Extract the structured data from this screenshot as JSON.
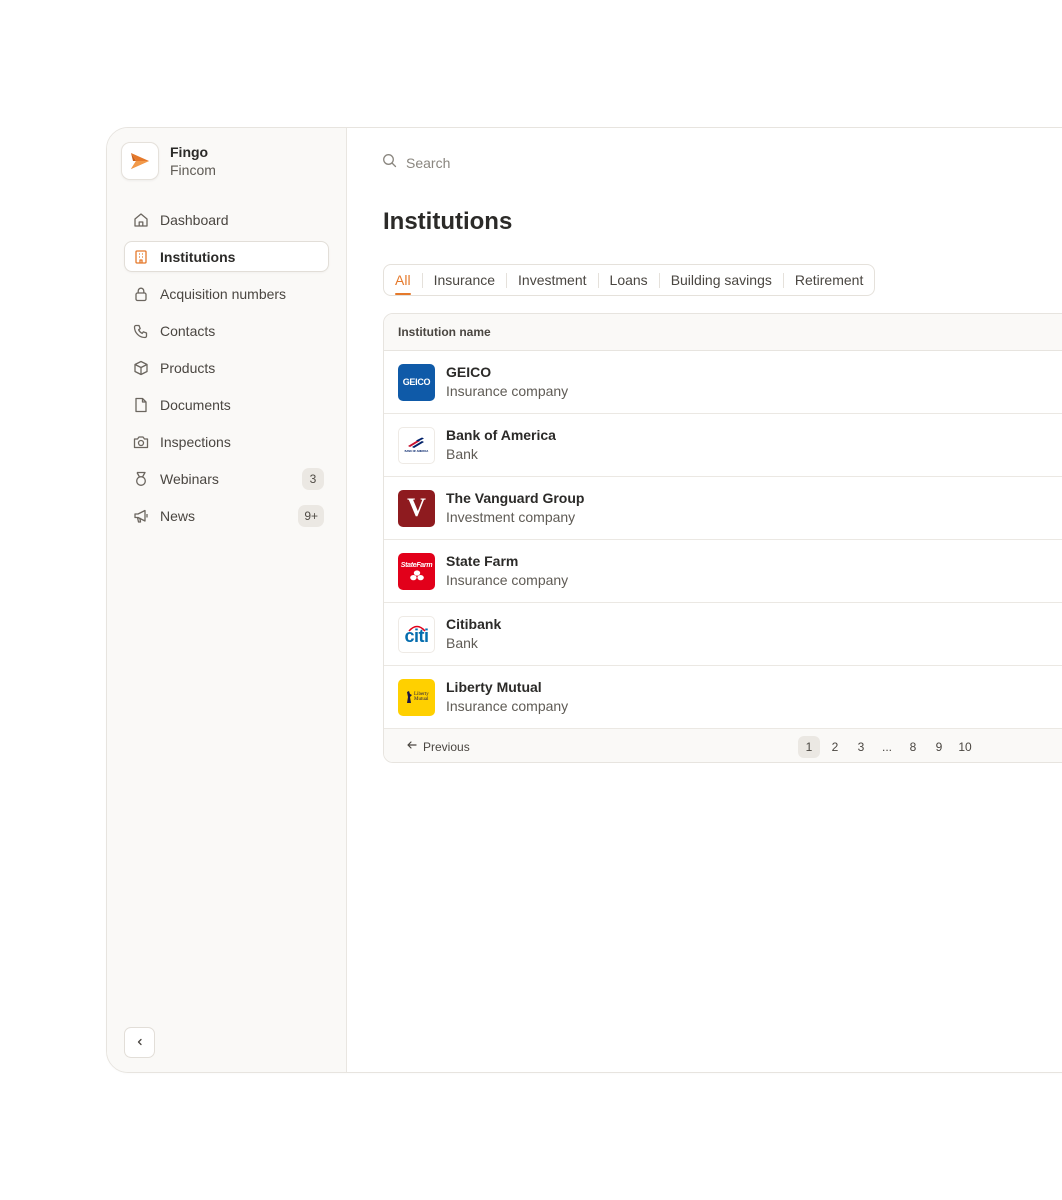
{
  "brand": {
    "name": "Fingo",
    "sub": "Fincom",
    "accent": "#e5792b"
  },
  "search": {
    "placeholder": "Search",
    "icon": "search-icon"
  },
  "sidebar": {
    "items": [
      {
        "label": "Dashboard",
        "icon": "home-icon",
        "active": false
      },
      {
        "label": "Institutions",
        "icon": "building-icon",
        "active": true
      },
      {
        "label": "Acquisition numbers",
        "icon": "lock-icon",
        "active": false
      },
      {
        "label": "Contacts",
        "icon": "phone-icon",
        "active": false
      },
      {
        "label": "Products",
        "icon": "box-icon",
        "active": false
      },
      {
        "label": "Documents",
        "icon": "file-icon",
        "active": false
      },
      {
        "label": "Inspections",
        "icon": "camera-icon",
        "active": false
      },
      {
        "label": "Webinars",
        "icon": "medal-icon",
        "active": false,
        "badge": "3"
      },
      {
        "label": "News",
        "icon": "megaphone-icon",
        "active": false,
        "badge": "9+"
      }
    ],
    "collapse_icon": "chevron-left-icon"
  },
  "page": {
    "title": "Institutions"
  },
  "tabs": [
    {
      "label": "All",
      "active": true
    },
    {
      "label": "Insurance",
      "active": false
    },
    {
      "label": "Investment",
      "active": false
    },
    {
      "label": "Loans",
      "active": false
    },
    {
      "label": "Building savings",
      "active": false
    },
    {
      "label": "Retirement",
      "active": false
    }
  ],
  "table": {
    "header": "Institution name",
    "rows": [
      {
        "name": "GEICO",
        "type": "Insurance company",
        "logo_text": "GEICO",
        "logo_color": "#0f5aa8"
      },
      {
        "name": "Bank of America",
        "type": "Bank",
        "logo_text": "BANK OF AMERICA",
        "logo_color": "#c8102e"
      },
      {
        "name": "The Vanguard Group",
        "type": "Investment company",
        "logo_text": "V",
        "logo_color": "#8e1b1f"
      },
      {
        "name": "State Farm",
        "type": "Insurance company",
        "logo_text": "StateFarm",
        "logo_color": "#e2001a"
      },
      {
        "name": "Citibank",
        "type": "Bank",
        "logo_text": "citi",
        "logo_color": "#056dae"
      },
      {
        "name": "Liberty Mutual",
        "type": "Insurance company",
        "logo_text": "Liberty Mutual",
        "logo_color": "#ffd000"
      }
    ]
  },
  "pagination": {
    "previous_label": "Previous",
    "pages": [
      "1",
      "2",
      "3",
      "...",
      "8",
      "9",
      "10"
    ],
    "current": "1"
  }
}
